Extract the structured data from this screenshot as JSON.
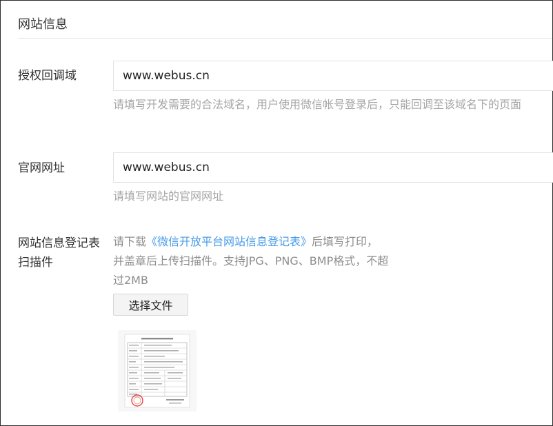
{
  "section": {
    "title": "网站信息"
  },
  "callback_domain": {
    "label": "授权回调域",
    "value": "www.webus.cn",
    "hint": "请填写开发需要的合法域名，用户使用微信帐号登录后，只能回调至该域名下的页面"
  },
  "website_url": {
    "label": "官网网址",
    "value": "www.webus.cn",
    "hint": "请填写网站的官网网址"
  },
  "registration_form": {
    "label": "网站信息登记表扫描件",
    "download_prefix": "请下载",
    "download_link": "《微信开放平台网站信息登记表》",
    "instructions": "后填写打印，并盖章后上传扫描件。支持JPG、PNG、BMP格式，不超过2MB",
    "choose_file_label": "选择文件",
    "stamp_color": "#e04a3f"
  }
}
